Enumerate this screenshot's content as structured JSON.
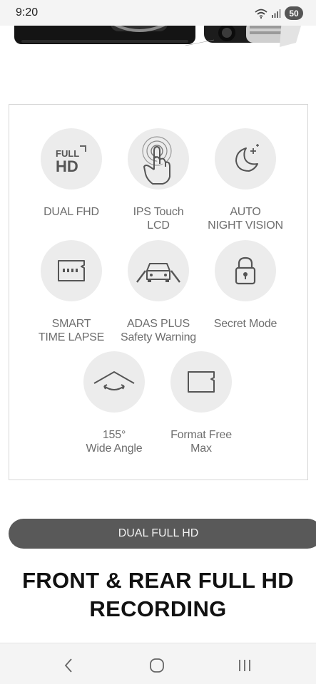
{
  "status": {
    "time": "9:20",
    "battery": "50"
  },
  "features": [
    {
      "label": "DUAL FHD",
      "icon": "full-hd-icon",
      "icon_text_top": "FULL",
      "icon_text_bottom": "HD"
    },
    {
      "label": "IPS Touch\nLCD",
      "icon": "touch-finger-icon"
    },
    {
      "label": "AUTO\nNIGHT VISION",
      "icon": "moon-stars-icon"
    },
    {
      "label": "SMART\nTIME LAPSE",
      "icon": "memory-card-icon"
    },
    {
      "label": "ADAS PLUS\nSafety Warning",
      "icon": "car-lanes-icon"
    },
    {
      "label": "Secret Mode",
      "icon": "padlock-icon"
    },
    {
      "label": "155°\nWide Angle",
      "icon": "wide-angle-icon"
    },
    {
      "label": "Format Free\nMax",
      "icon": "sd-card-icon"
    }
  ],
  "banner": {
    "label": "DUAL FULL HD"
  },
  "headline": {
    "text": "FRONT & REAR FULL HD\nRECORDING"
  },
  "nav": {
    "back_icon": "back-chevron-icon",
    "home_icon": "home-circle-icon",
    "recents_icon": "recent-apps-icon"
  }
}
